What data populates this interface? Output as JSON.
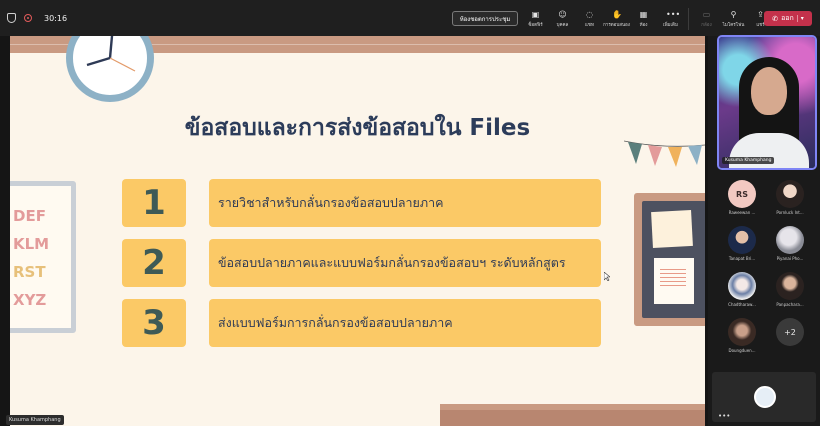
{
  "topbar": {
    "timer": "30:16",
    "meeting_button": "ห้องชอตการประชุม",
    "tools": [
      {
        "label": "ซ็อตฟิร์",
        "icon": "open-chat-icon"
      },
      {
        "label": "บุคคล",
        "icon": "people-icon"
      },
      {
        "label": "แชท",
        "icon": "chat-icon"
      },
      {
        "label": "การตอบสนอง",
        "icon": "react-icon"
      },
      {
        "label": "ห้อง",
        "icon": "rooms-icon"
      },
      {
        "label": "เพิ่มเติม",
        "icon": "more-icon"
      },
      {
        "label": "กล้อง",
        "icon": "camera-icon"
      },
      {
        "label": "ไมโครโฟน",
        "icon": "mic-icon"
      },
      {
        "label": "แชร์",
        "icon": "share-icon"
      }
    ],
    "leave_label": "ออก"
  },
  "slide": {
    "title": "ข้อสอบและการส่งข้อสอบใน Files",
    "items": [
      {
        "number": "1",
        "text": "รายวิชาสำหรับกลั่นกรองข้อสอบปลายภาค"
      },
      {
        "number": "2",
        "text": "ข้อสอบปลายภาคและแบบฟอร์มกลั่นกรองข้อสอบฯ ระดับหลักสูตร"
      },
      {
        "number": "3",
        "text": "ส่งแบบฟอร์มการกลั่นกรองข้อสอบปลายภาค"
      }
    ],
    "alphabet_lines": [
      "DEF",
      "KLM",
      "RST",
      "XYZ"
    ],
    "presenter_tag": "Kusuma Khamphang"
  },
  "speaker": {
    "name": "Kusuma Khamphang"
  },
  "participants": [
    {
      "initials": "RS",
      "name": "Raweewan ...",
      "color": "#f2c9c2"
    },
    {
      "initials": "",
      "name": "Pornluck Int...",
      "color": "#d9c2b0"
    },
    {
      "initials": "",
      "name": "Tanapat Bri...",
      "color": "#3b6fb0"
    },
    {
      "initials": "",
      "name": "Piyanai Pho...",
      "color": "#c9ccd6"
    },
    {
      "initials": "",
      "name": "Chadtharaw...",
      "color": "#6b7fa6"
    },
    {
      "initials": "",
      "name": "Panpachara...",
      "color": "#5b4a44"
    },
    {
      "initials": "",
      "name": "Doungduen...",
      "color": "#7a5a4a"
    }
  ],
  "more_count": "+2",
  "colors": {
    "accent": "#7f85f5",
    "leave": "#c4314b",
    "card": "#fbc966"
  }
}
